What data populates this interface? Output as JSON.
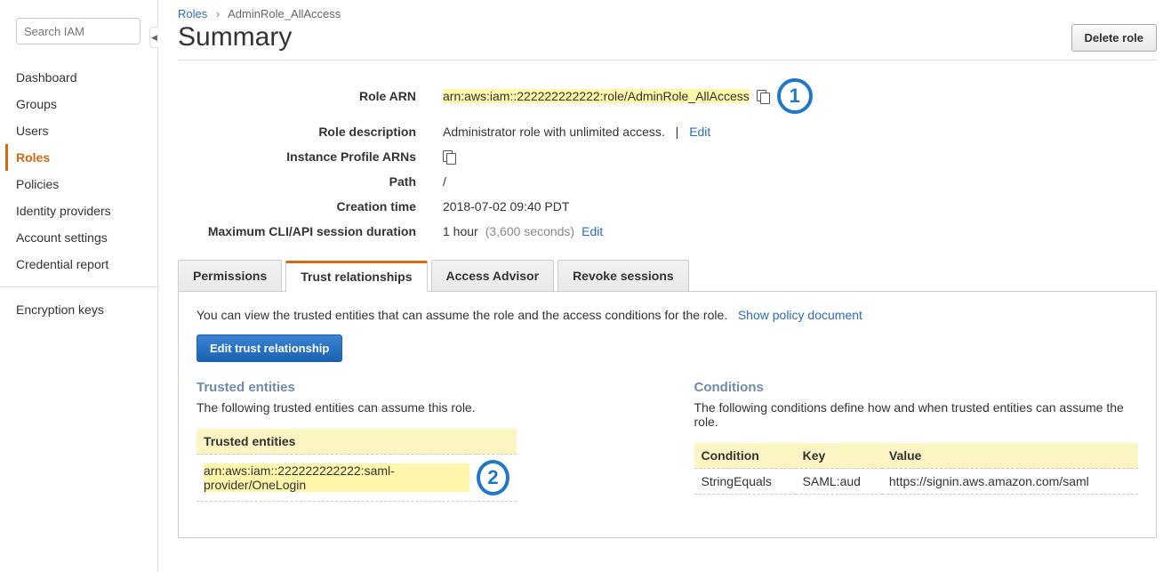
{
  "sidebar": {
    "search_placeholder": "Search IAM",
    "items": [
      {
        "label": "Dashboard"
      },
      {
        "label": "Groups"
      },
      {
        "label": "Users"
      },
      {
        "label": "Roles",
        "active": true
      },
      {
        "label": "Policies"
      },
      {
        "label": "Identity providers"
      },
      {
        "label": "Account settings"
      },
      {
        "label": "Credential report"
      }
    ],
    "extra_item": "Encryption keys"
  },
  "breadcrumb": {
    "root": "Roles",
    "current": "AdminRole_AllAccess"
  },
  "page_title": "Summary",
  "delete_button": "Delete role",
  "details": {
    "role_arn_label": "Role ARN",
    "role_arn_value": "arn:aws:iam::222222222222:role/AdminRole_AllAccess",
    "role_desc_label": "Role description",
    "role_desc_value": "Administrator role with unlimited access.",
    "edit_link": "Edit",
    "instance_profile_label": "Instance Profile ARNs",
    "path_label": "Path",
    "path_value": "/",
    "creation_label": "Creation time",
    "creation_value": "2018-07-02 09:40 PDT",
    "max_session_label": "Maximum CLI/API session duration",
    "max_session_value": "1 hour",
    "max_session_seconds": "(3,600 seconds)"
  },
  "callouts": {
    "one": "1",
    "two": "2"
  },
  "tabs": {
    "permissions": "Permissions",
    "trust": "Trust relationships",
    "access": "Access Advisor",
    "revoke": "Revoke sessions"
  },
  "trust_panel": {
    "desc": "You can view the trusted entities that can assume the role and the access conditions for the role.",
    "show_policy_link": "Show policy document",
    "edit_button": "Edit trust relationship",
    "entities_title": "Trusted entities",
    "entities_desc": "The following trusted entities can assume this role.",
    "entities_header": "Trusted entities",
    "entities_value": "arn:aws:iam::222222222222:saml-provider/OneLogin",
    "conditions_title": "Conditions",
    "conditions_desc": "The following conditions define how and when trusted entities can assume the role.",
    "conditions_headers": {
      "cond": "Condition",
      "key": "Key",
      "value": "Value"
    },
    "conditions_row": {
      "cond": "StringEquals",
      "key": "SAML:aud",
      "value": "https://signin.aws.amazon.com/saml"
    }
  }
}
